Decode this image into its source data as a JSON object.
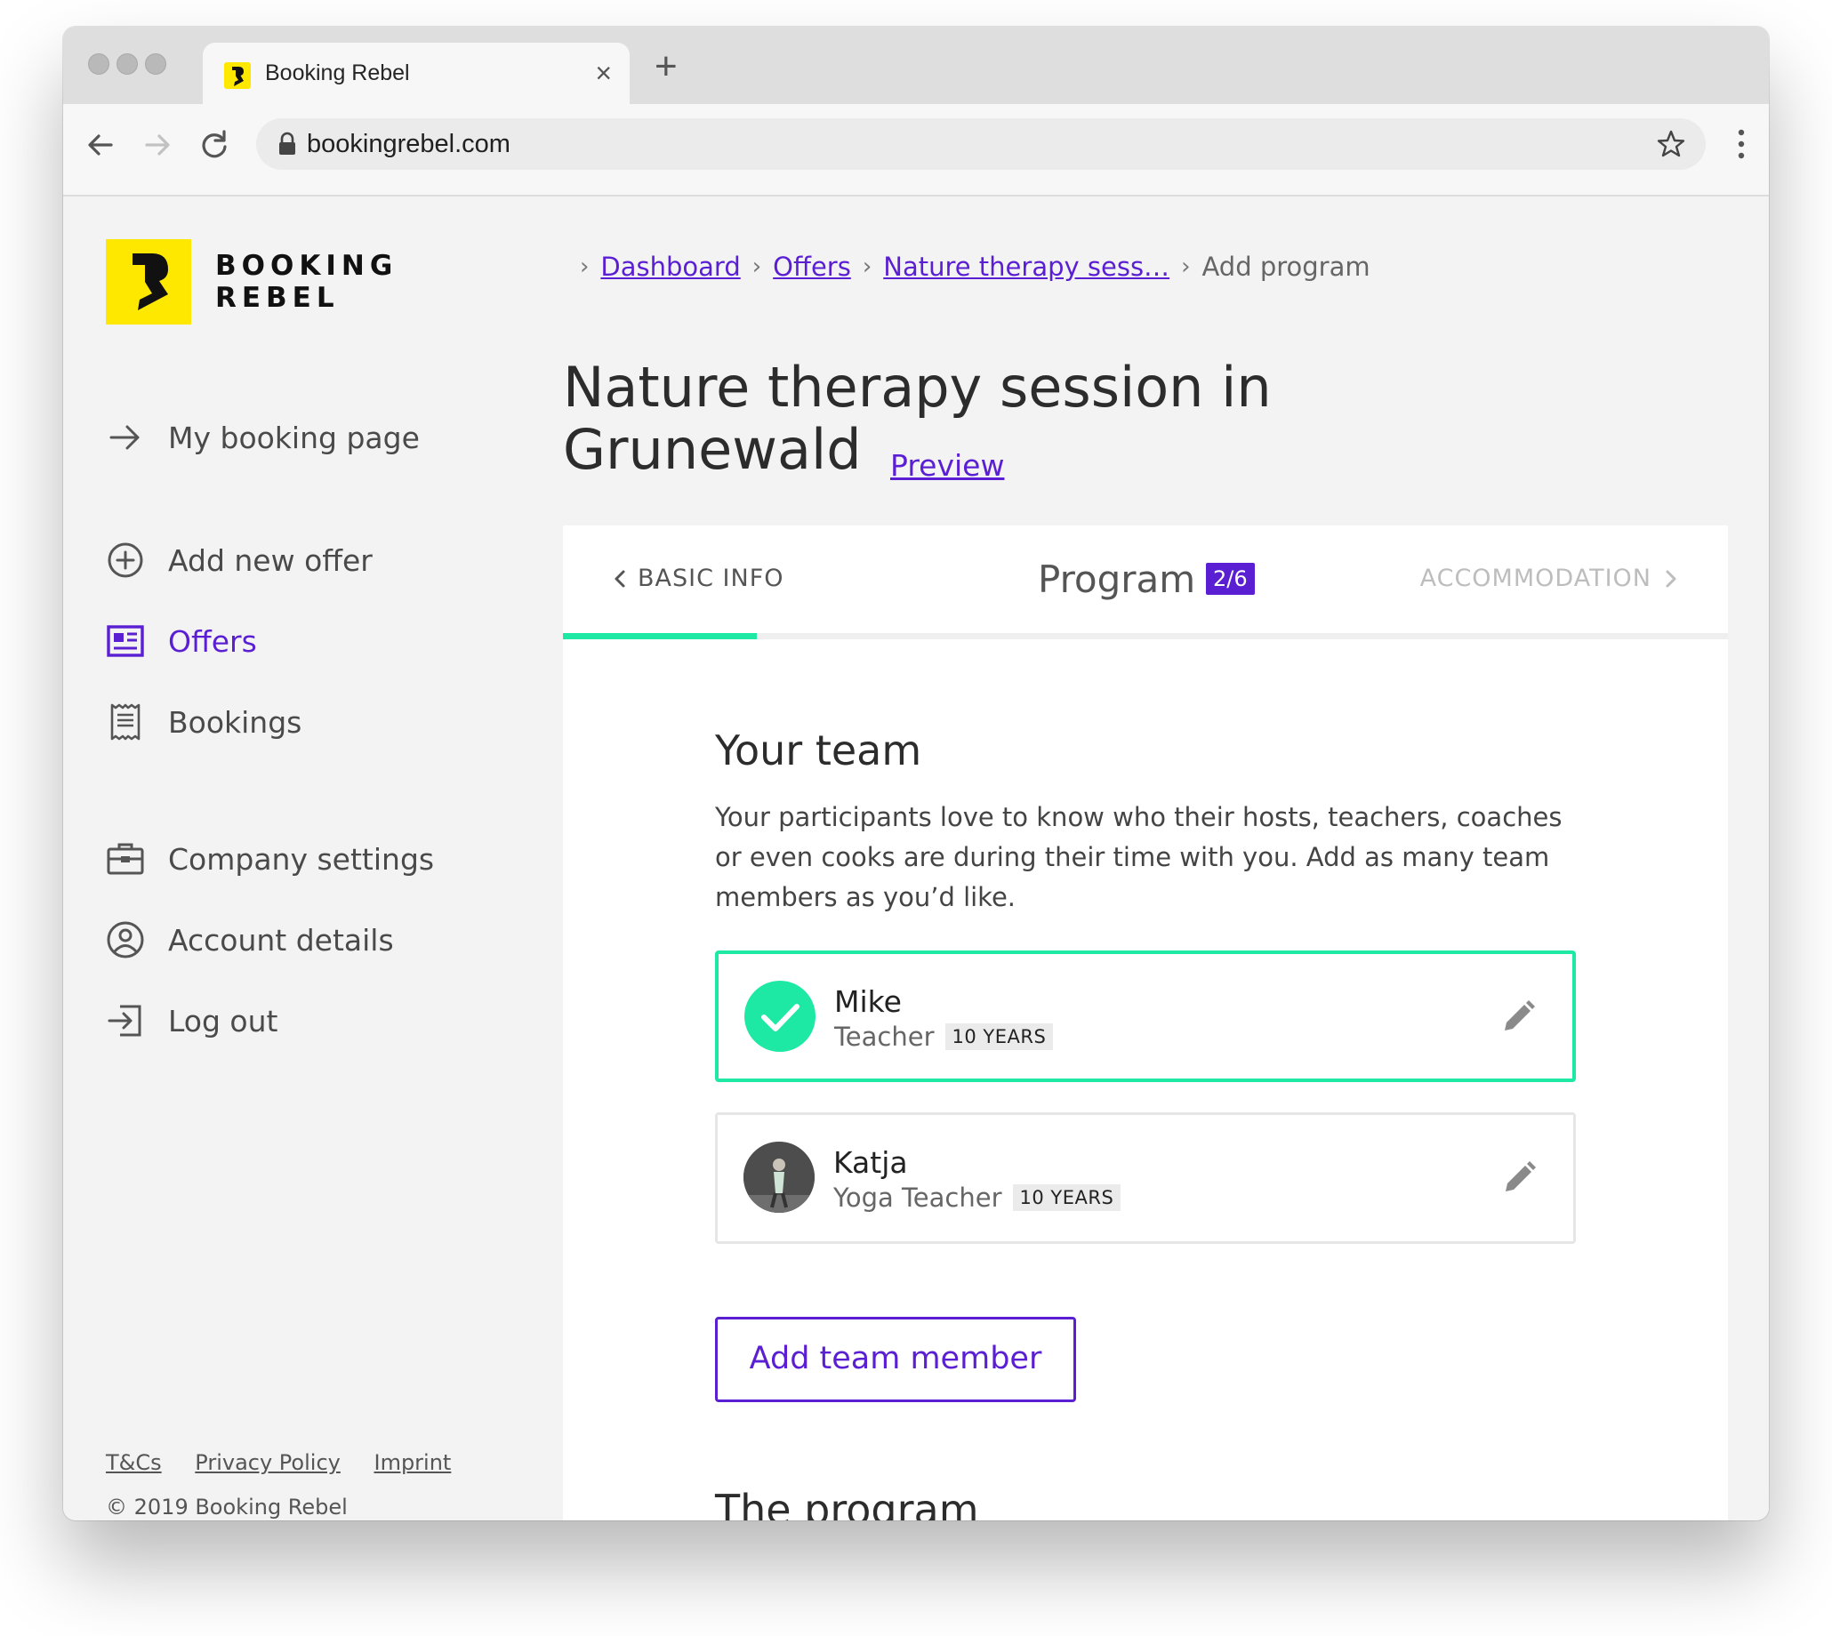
{
  "browser": {
    "tab_title": "Booking Rebel",
    "tab_close": "×",
    "new_tab": "+",
    "url": "bookingrebel.com"
  },
  "brand": {
    "line1": "BOOKING",
    "line2": "REBEL",
    "color": "#ffe800"
  },
  "sidebar": {
    "items": [
      {
        "label": "My booking page",
        "icon": "arrow-right-icon"
      },
      {
        "label": "Add new offer",
        "icon": "plus-circle-icon"
      },
      {
        "label": "Offers",
        "icon": "offers-card-icon",
        "active": true
      },
      {
        "label": "Bookings",
        "icon": "receipt-icon"
      },
      {
        "label": "Company settings",
        "icon": "briefcase-icon"
      },
      {
        "label": "Account details",
        "icon": "user-circle-icon"
      },
      {
        "label": "Log out",
        "icon": "logout-icon"
      }
    ],
    "footer_links": [
      "T&Cs",
      "Privacy Policy",
      "Imprint"
    ],
    "copyright": "© 2019 Booking Rebel"
  },
  "breadcrumb": {
    "items": [
      "Dashboard",
      "Offers",
      "Nature therapy sess…"
    ],
    "current": "Add program"
  },
  "page": {
    "title": "Nature therapy session in Grunewald",
    "preview_label": "Preview"
  },
  "steps": {
    "back_label": "BASIC INFO",
    "current_label": "Program",
    "current_badge": "2/6",
    "next_label": "ACCOMMODATION",
    "progress_fraction": 0.1667
  },
  "team": {
    "title": "Your team",
    "description": "Your participants love to know who their hosts, teachers, coaches or even cooks are during their time with you. Add as many team members as you’d like.",
    "members": [
      {
        "name": "Mike",
        "role": "Teacher",
        "experience": "10 YEARS",
        "selected": true
      },
      {
        "name": "Katja",
        "role": "Yoga Teacher",
        "experience": "10 YEARS",
        "selected": false
      }
    ],
    "add_button_label": "Add team member"
  },
  "program": {
    "title": "The program"
  },
  "colors": {
    "accent": "#5b1fd3",
    "success": "#1de9a5",
    "brand_yellow": "#ffe800"
  }
}
